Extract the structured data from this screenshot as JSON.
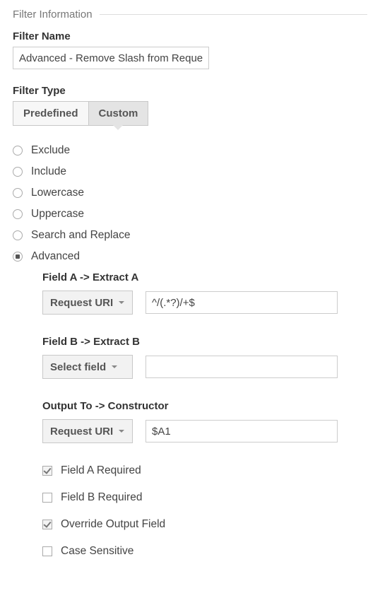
{
  "legend": "Filter Information",
  "filter_name_label": "Filter Name",
  "filter_name_value": "Advanced - Remove Slash from Request URI",
  "filter_type_label": "Filter Type",
  "tabs": {
    "predefined": "Predefined",
    "custom": "Custom"
  },
  "radios": {
    "exclude": "Exclude",
    "include": "Include",
    "lowercase": "Lowercase",
    "uppercase": "Uppercase",
    "search_replace": "Search and Replace",
    "advanced": "Advanced"
  },
  "advanced": {
    "field_a_label": "Field A -> Extract A",
    "field_a_dropdown": "Request URI",
    "field_a_pattern": "^/(.*?)/+$",
    "field_b_label": "Field B -> Extract B",
    "field_b_dropdown": "Select field",
    "field_b_pattern": "",
    "output_label": "Output To -> Constructor",
    "output_dropdown": "Request URI",
    "output_pattern": "$A1",
    "checks": {
      "field_a_required": "Field A Required",
      "field_b_required": "Field B Required",
      "override_output": "Override Output Field",
      "case_sensitive": "Case Sensitive"
    }
  }
}
